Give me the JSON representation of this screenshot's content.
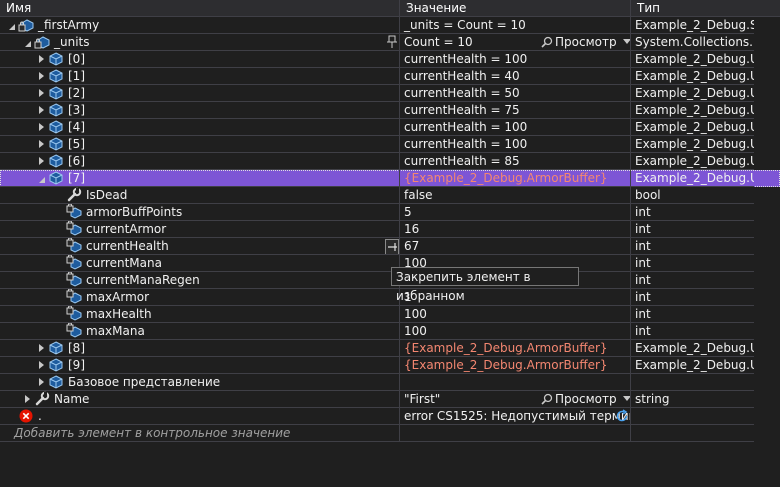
{
  "headers": {
    "name": "Имя",
    "value": "Значение",
    "type": "Тип"
  },
  "rows": [
    {
      "indent": 0,
      "expand": "down",
      "icon": "locked-object-icon",
      "name": "_firstArmy",
      "value": "_units = Count = 10",
      "type": "Example_2_Debug.S..."
    },
    {
      "indent": 1,
      "expand": "down",
      "icon": "locked-object-icon",
      "name": "_units",
      "value": "Count = 10",
      "type": "System.Collections....",
      "pin": true,
      "viewer": "Просмотр"
    },
    {
      "indent": 2,
      "expand": "right",
      "icon": "object-icon",
      "name": "[0]",
      "value": "currentHealth = 100",
      "type": "Example_2_Debug.U..."
    },
    {
      "indent": 2,
      "expand": "right",
      "icon": "object-icon",
      "name": "[1]",
      "value": "currentHealth = 40",
      "type": "Example_2_Debug.U..."
    },
    {
      "indent": 2,
      "expand": "right",
      "icon": "object-icon",
      "name": "[2]",
      "value": "currentHealth = 50",
      "type": "Example_2_Debug.U..."
    },
    {
      "indent": 2,
      "expand": "right",
      "icon": "object-icon",
      "name": "[3]",
      "value": "currentHealth = 75",
      "type": "Example_2_Debug.U..."
    },
    {
      "indent": 2,
      "expand": "right",
      "icon": "object-icon",
      "name": "[4]",
      "value": "currentHealth = 100",
      "type": "Example_2_Debug.U..."
    },
    {
      "indent": 2,
      "expand": "right",
      "icon": "object-icon",
      "name": "[5]",
      "value": "currentHealth = 100",
      "type": "Example_2_Debug.U..."
    },
    {
      "indent": 2,
      "expand": "right",
      "icon": "object-icon",
      "name": "[6]",
      "value": "currentHealth = 85",
      "type": "Example_2_Debug.U..."
    },
    {
      "indent": 2,
      "expand": "down",
      "icon": "object-icon",
      "name": "[7]",
      "value": "{Example_2_Debug.ArmorBuffer}",
      "type": "Example_2_Debug.U...",
      "selected": true,
      "red": true
    },
    {
      "indent": 3,
      "expand": "none",
      "icon": "wrench-icon",
      "name": "IsDead",
      "value": "false",
      "type": "bool"
    },
    {
      "indent": 3,
      "expand": "none",
      "icon": "locked-field-icon",
      "name": "armorBuffPoints",
      "value": "5",
      "type": "int"
    },
    {
      "indent": 3,
      "expand": "none",
      "icon": "locked-field-icon",
      "name": "currentArmor",
      "value": "16",
      "type": "int"
    },
    {
      "indent": 3,
      "expand": "none",
      "icon": "locked-field-icon",
      "name": "currentHealth",
      "value": "67",
      "type": "int",
      "pin2": true
    },
    {
      "indent": 3,
      "expand": "none",
      "icon": "locked-field-icon",
      "name": "currentMana",
      "value": "100",
      "type": "int"
    },
    {
      "indent": 3,
      "expand": "none",
      "icon": "locked-field-icon",
      "name": "currentManaRegen",
      "value": "",
      "type": "int"
    },
    {
      "indent": 3,
      "expand": "none",
      "icon": "locked-field-icon",
      "name": "maxArmor",
      "value": "1",
      "type": "int"
    },
    {
      "indent": 3,
      "expand": "none",
      "icon": "locked-field-icon",
      "name": "maxHealth",
      "value": "100",
      "type": "int"
    },
    {
      "indent": 3,
      "expand": "none",
      "icon": "locked-field-icon",
      "name": "maxMana",
      "value": "100",
      "type": "int"
    },
    {
      "indent": 2,
      "expand": "right",
      "icon": "object-icon",
      "name": "[8]",
      "value": "{Example_2_Debug.ArmorBuffer}",
      "type": "Example_2_Debug.U...",
      "red": true
    },
    {
      "indent": 2,
      "expand": "right",
      "icon": "object-icon",
      "name": "[9]",
      "value": "{Example_2_Debug.ArmorBuffer}",
      "type": "Example_2_Debug.U...",
      "red": true
    },
    {
      "indent": 2,
      "expand": "right",
      "icon": "object-icon",
      "name": "Базовое представление",
      "value": "",
      "type": ""
    },
    {
      "indent": 1,
      "expand": "right",
      "icon": "wrench-icon",
      "name": "Name",
      "value": "\"First\"",
      "type": "string",
      "viewer": "Просмотр"
    },
    {
      "indent": 0,
      "expand": "none",
      "icon": "error-icon",
      "name": ".",
      "value": "error CS1525: Недопустимый термин...",
      "type": "",
      "refresh": true
    }
  ],
  "add_row": {
    "placeholder": "Добавить элемент в контрольное значение"
  },
  "tooltip": {
    "text": "Закрепить элемент в избранном"
  },
  "colors": {
    "selected": "#7d55d5",
    "error_value": "#f48771",
    "background": "#1f1f1f"
  }
}
